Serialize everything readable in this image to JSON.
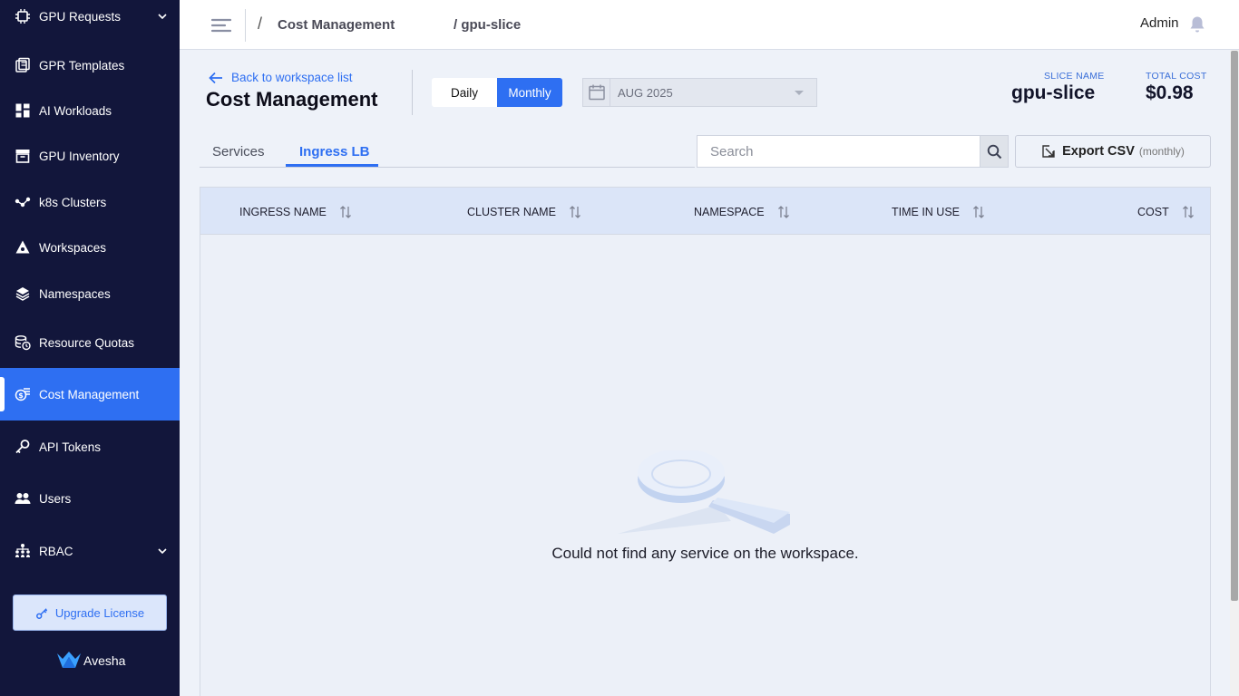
{
  "sidebar": {
    "items": [
      {
        "label": "GPU Requests",
        "icon": "chip-icon"
      },
      {
        "label": "GPR Templates",
        "icon": "template-icon"
      },
      {
        "label": "AI Workloads",
        "icon": "dashboard-icon"
      },
      {
        "label": "GPU Inventory",
        "icon": "archive-icon"
      },
      {
        "label": "k8s Clusters",
        "icon": "cluster-icon"
      },
      {
        "label": "Workspaces",
        "icon": "workspace-icon"
      },
      {
        "label": "Namespaces",
        "icon": "layers-icon"
      },
      {
        "label": "Resource Quotas",
        "icon": "coins-icon"
      },
      {
        "label": "Cost Management",
        "icon": "cost-icon",
        "active": true
      },
      {
        "label": "API Tokens",
        "icon": "key-icon"
      },
      {
        "label": "Users",
        "icon": "users-icon"
      },
      {
        "label": "RBAC",
        "icon": "rbac-icon"
      }
    ],
    "upgrade_label": "Upgrade License",
    "brand": "Avesha"
  },
  "topbar": {
    "separator": "/",
    "crumb1": "Cost Management",
    "crumb2": "/ gpu-slice",
    "user": "Admin"
  },
  "header": {
    "back_label": "Back to workspace list",
    "title": "Cost Management",
    "toggle": {
      "daily": "Daily",
      "monthly": "Monthly",
      "selected": "Monthly"
    },
    "date_value": "AUG 2025",
    "slice_label": "SLICE NAME",
    "slice_value": "gpu-slice",
    "cost_label": "TOTAL COST",
    "cost_value": "$0.98"
  },
  "tabs": {
    "services": "Services",
    "ingress": "Ingress LB",
    "active": "Ingress LB"
  },
  "search": {
    "placeholder": "Search",
    "value": ""
  },
  "export": {
    "label": "Export CSV",
    "sub": "(monthly)"
  },
  "table": {
    "columns": [
      "INGRESS NAME",
      "CLUSTER NAME",
      "NAMESPACE",
      "TIME IN USE",
      "COST"
    ],
    "rows": [],
    "empty_message": "Could not find any service on the workspace."
  },
  "colors": {
    "accent": "#2e6ff2",
    "sidebar": "#12163b"
  }
}
